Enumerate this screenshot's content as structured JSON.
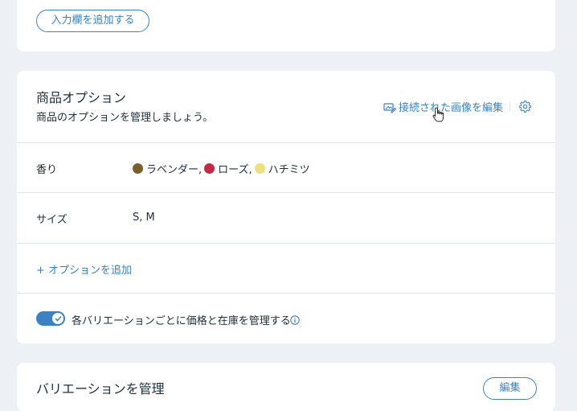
{
  "top_card": {
    "add_field_label": "入力欄を追加する"
  },
  "options_card": {
    "title": "商品オプション",
    "subtitle": "商品のオプションを管理しましょう。",
    "edit_images_link": "接続された画像を編集",
    "options": [
      {
        "name": "香り",
        "choices": [
          {
            "label": "ラベンダー,",
            "color": "#7a5f2a"
          },
          {
            "label": "ローズ,",
            "color": "#c22a45"
          },
          {
            "label": "ハチミツ",
            "color": "#ebe27c"
          }
        ]
      },
      {
        "name": "サイズ",
        "value": "S, M"
      }
    ],
    "add_option_label": "+ オプションを追加",
    "toggle_label": "各バリエーションごとに価格と在庫を管理する",
    "toggle_on": true
  },
  "variations_card": {
    "title": "バリエーションを管理",
    "edit_button_label": "編集"
  },
  "colors": {
    "accent": "#3a82c4",
    "background": "#edf0f4"
  }
}
